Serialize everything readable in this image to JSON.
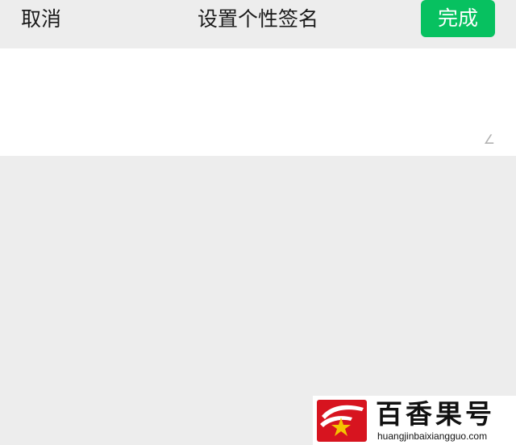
{
  "nav": {
    "cancel_label": "取消",
    "title": "设置个性签名",
    "done_label": "完成"
  },
  "signature": {
    "value": "",
    "counter": "∠"
  },
  "watermark": {
    "name": "百香果号",
    "url": "huangjinbaixiangguo.com"
  },
  "colors": {
    "primary_green": "#07c160",
    "background": "#ededed",
    "panel": "#ffffff",
    "logo_red": "#d7141f"
  }
}
